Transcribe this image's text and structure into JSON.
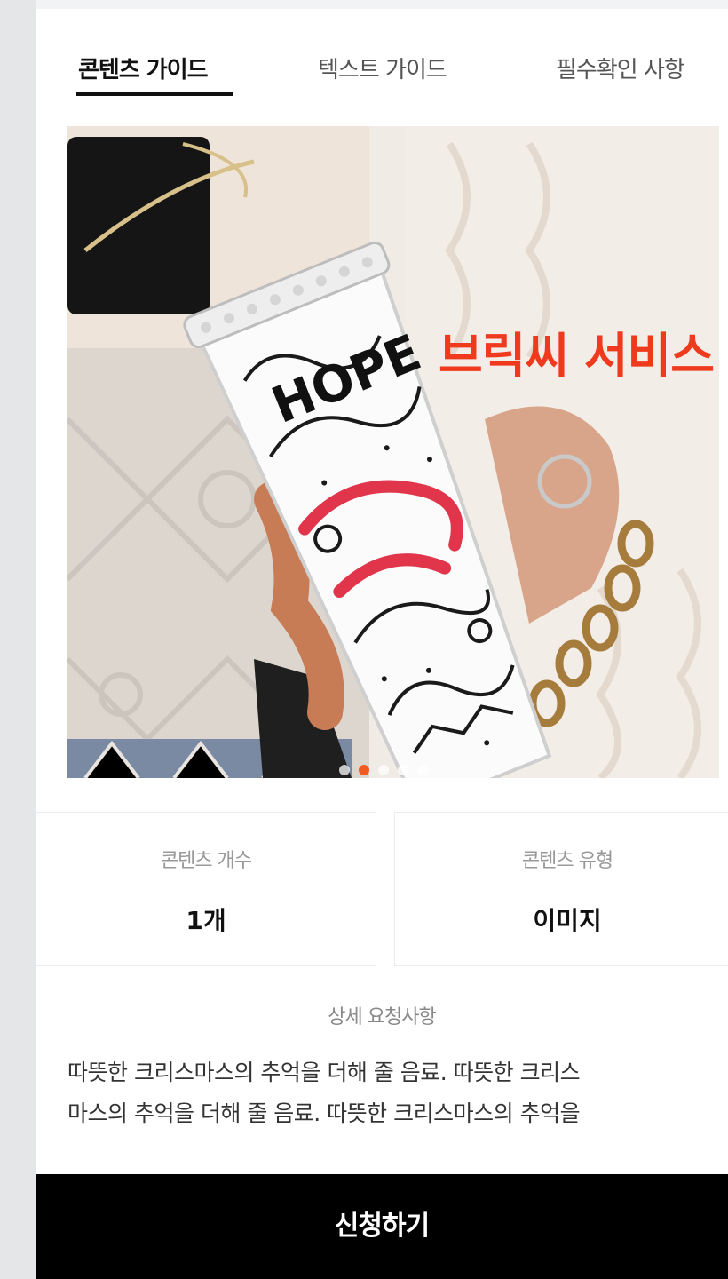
{
  "tabs": [
    {
      "label": "콘텐츠 가이드",
      "active": true
    },
    {
      "label": "텍스트 가이드",
      "active": false
    },
    {
      "label": "필수확인 사항",
      "active": false
    }
  ],
  "hero": {
    "overlay_text": "브릭씨 서비스",
    "cup_text": "HOPE",
    "carousel_dots": 5,
    "active_dot": 1,
    "accent_color": "#f03a1e"
  },
  "info": {
    "count_label": "콘텐츠 개수",
    "count_value": "1개",
    "type_label": "콘텐츠 유형",
    "type_value": "이미지"
  },
  "detail": {
    "title": "상세 요청사항",
    "line1": "따뜻한 크리스마스의 추억을  더해 줄 음료. 따뜻한 크리스",
    "line2": "마스의 추억을  더해 줄 음료. 따뜻한 크리스마스의 추억을"
  },
  "cta": {
    "label": "신청하기"
  }
}
